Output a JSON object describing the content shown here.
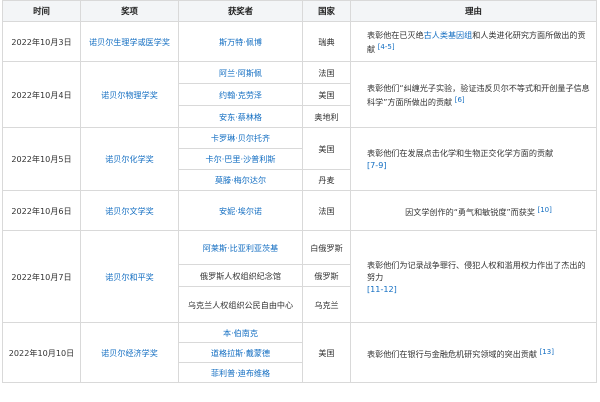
{
  "headers": [
    "时间",
    "奖项",
    "获奖者",
    "国家",
    "理由"
  ],
  "rows": [
    {
      "date": "2022年10月3日",
      "award": "诺贝尔生理学或医学奖",
      "winners": [
        {
          "name": "斯万特·佩博",
          "country": "瑞典"
        }
      ],
      "reason": {
        "before": "表彰他在已灭绝",
        "link": "古人类基因组",
        "after": "和人类进化研究方面所做出的贡献",
        "ref": "[4-5]"
      }
    },
    {
      "date": "2022年10月4日",
      "award": "诺贝尔物理学奖",
      "winners": [
        {
          "name": "阿兰·阿斯佩",
          "country": "法国"
        },
        {
          "name": "约翰·克劳泽",
          "country": "美国"
        },
        {
          "name": "安东·蔡林格",
          "country": "奥地利"
        }
      ],
      "reason": {
        "before": "表彰他们“纠缠光子实验，验证违反贝尔不等式和开创量子信息科学”方面所做出的贡献",
        "link": "",
        "after": "",
        "ref": "[6]"
      }
    },
    {
      "date": "2022年10月5日",
      "award": "诺贝尔化学奖",
      "winners": [
        {
          "name": "卡罗琳·贝尔托齐",
          "country": "美国"
        },
        {
          "name": "卡尔·巴里·沙普利斯",
          "country": ""
        },
        {
          "name": "莫滕·梅尔达尔",
          "country": "丹麦"
        }
      ],
      "reason": {
        "before": "表彰他们在发展点击化学和生物正交化学方面的贡献",
        "link": "",
        "after": "",
        "ref": "[7-9]"
      }
    },
    {
      "date": "2022年10月6日",
      "award": "诺贝尔文学奖",
      "winners": [
        {
          "name": "安妮·埃尔诺",
          "country": "法国"
        }
      ],
      "reason": {
        "before": "因文学创作的“勇气和敏锐度”而获奖",
        "link": "",
        "after": "",
        "ref": "[10]"
      }
    },
    {
      "date": "2022年10月7日",
      "award": "诺贝尔和平奖",
      "winners": [
        {
          "name": "阿莱斯·比亚利亚茨基",
          "country": "白俄罗斯"
        },
        {
          "name": "俄罗斯人权组织纪念馆",
          "country": "俄罗斯"
        },
        {
          "name": "乌克兰人权组织公民自由中心",
          "country": "乌克兰"
        }
      ],
      "reason": {
        "before": "表彰他们为记录战争罪行、侵犯人权和滥用权力作出了杰出的努力",
        "link": "",
        "after": "",
        "ref": "[11-12]"
      }
    },
    {
      "date": "2022年10月10日",
      "award": "诺贝尔经济学奖",
      "winners": [
        {
          "name": "本·伯南克",
          "country": "美国"
        },
        {
          "name": "道格拉斯·戴蒙德",
          "country": ""
        },
        {
          "name": "菲利普·迪布维格",
          "country": ""
        }
      ],
      "reason": {
        "before": "表彰他们在银行与金融危机研究领域的突出贡献",
        "link": "",
        "after": "",
        "ref": "[13]"
      }
    }
  ]
}
